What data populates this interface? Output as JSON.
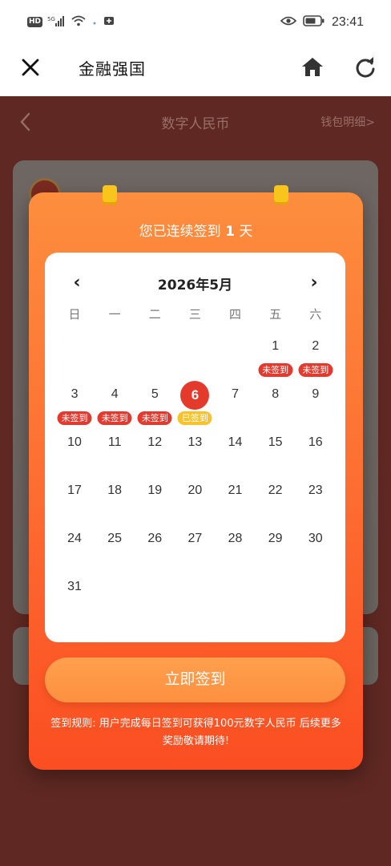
{
  "status_bar": {
    "left_badges": [
      "HD",
      "5G"
    ],
    "time": "23:41",
    "icons": [
      "eye-icon",
      "battery-icon",
      "wifi-icon",
      "signal-icon"
    ]
  },
  "app_bar": {
    "title": "金融强国",
    "close_icon": "close-icon",
    "home_icon": "home-icon",
    "refresh_icon": "refresh-icon"
  },
  "background_page": {
    "title": "数字人民币",
    "wallet_link": "钱包明细>"
  },
  "checkin": {
    "streak_prefix": "您已连续签到 ",
    "streak_days": "1",
    "streak_suffix": " 天",
    "calendar": {
      "prev": "‹",
      "next": "›",
      "month_label": "2026年5月",
      "weekdays": [
        "日",
        "一",
        "二",
        "三",
        "四",
        "五",
        "六"
      ],
      "leading_blank_days": 5,
      "days_in_month": 31,
      "today": 6,
      "status_labels": {
        "missed": "未签到",
        "signed": "已签到"
      },
      "day_status": {
        "1": "missed",
        "2": "missed",
        "3": "missed",
        "4": "missed",
        "5": "missed",
        "6": "signed"
      }
    },
    "button_label": "立即签到",
    "rules": "签到规则: 用户完成每日签到可获得100元数字人民币 后续更多奖励敬请期待!"
  },
  "colors": {
    "accent_orange": "#fd8e3e",
    "today_red": "#e43a2c",
    "missed_red": "#e23a2f",
    "signed_yellow": "#f7c22b",
    "backdrop": "#5f2822"
  }
}
